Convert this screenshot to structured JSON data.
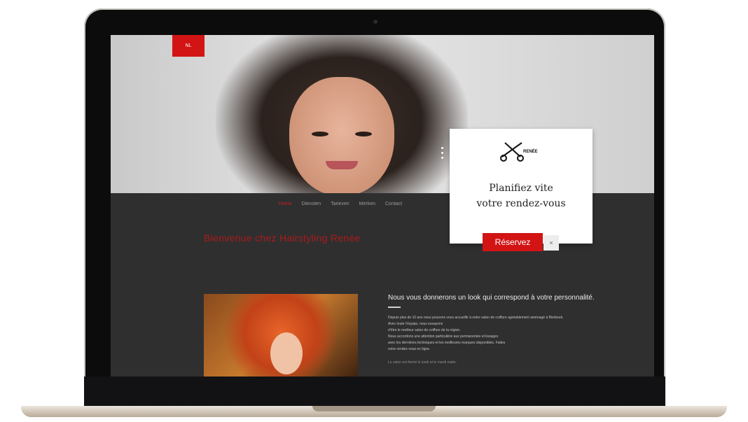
{
  "hero": {
    "language_badge": "NL"
  },
  "nav": {
    "items": [
      {
        "label": "Home",
        "active": true
      },
      {
        "label": "Diensten",
        "active": false
      },
      {
        "label": "Tarieven",
        "active": false
      },
      {
        "label": "Merken",
        "active": false
      },
      {
        "label": "Contact",
        "active": false
      }
    ]
  },
  "section": {
    "title": "Bienvenue chez Hairstyling Renée"
  },
  "about": {
    "heading": "Nous vous donnerons un look qui correspond à votre personnalité.",
    "paragraphs": [
      "Depuis plus de 10 ans nous pouvons vous accueillir à notre salon de coiffure agréablement aménagé à Bierbeek. Avec toute l’équipe, nous essayons",
      "d’être le meilleur salon de coiffure de la région.",
      "Nous accordons une attention particulière aux permanentes et lissages",
      "avec les dernières techniques et les meilleures marques disponibles. Faites",
      "votre rendez-vous en ligne."
    ],
    "footer": "Le salon est fermé le lundi et le mardi matin."
  },
  "popup": {
    "brand": "RENÉE",
    "title_line1": "Planifiez vite",
    "title_line2": "votre rendez-vous",
    "reserve_label": "Réservez",
    "close_label": "×"
  },
  "colors": {
    "accent": "#d21414",
    "page_bg": "#2f2f30",
    "popup_bg": "#ffffff"
  }
}
